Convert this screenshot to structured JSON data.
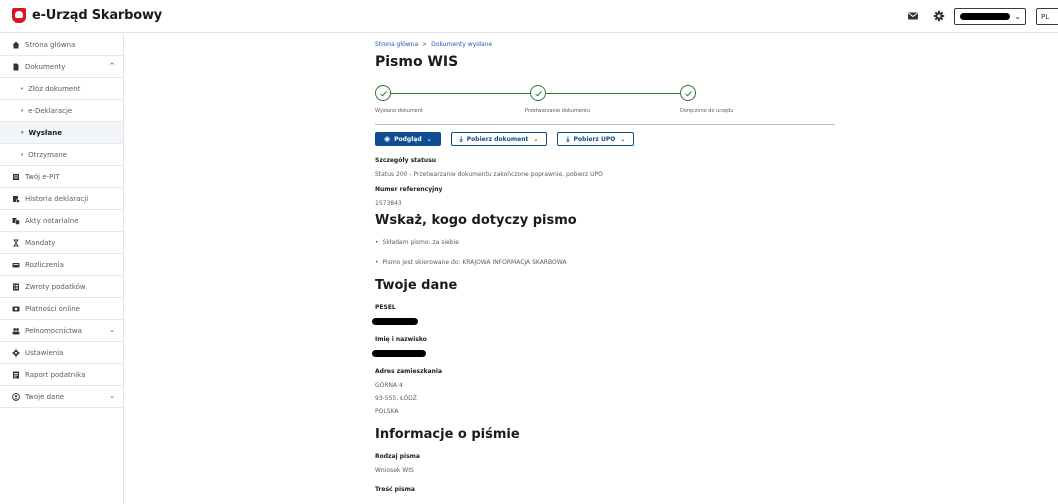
{
  "header": {
    "app_title": "e-Urząd Skarbowy",
    "lang": "PL"
  },
  "sidebar": {
    "items": [
      {
        "label": "Strona główna",
        "icon": "home-icon"
      },
      {
        "label": "Dokumenty",
        "icon": "document-icon",
        "expanded": true
      },
      {
        "label": "Złóż dokument",
        "sub": true
      },
      {
        "label": "e-Deklaracje",
        "sub": true
      },
      {
        "label": "Wysłane",
        "sub": true,
        "active": true
      },
      {
        "label": "Otrzymane",
        "sub": true
      },
      {
        "label": "Twój e-PIT",
        "icon": "pit-icon"
      },
      {
        "label": "Historia deklaracji",
        "icon": "history-icon"
      },
      {
        "label": "Akty notarialne",
        "icon": "notary-icon"
      },
      {
        "label": "Mandaty",
        "icon": "ticket-icon"
      },
      {
        "label": "Rozliczenia",
        "icon": "settlement-icon"
      },
      {
        "label": "Zwroty podatków",
        "icon": "refund-icon"
      },
      {
        "label": "Płatności online",
        "icon": "payment-icon"
      },
      {
        "label": "Pełnomocnictwa",
        "icon": "proxy-icon",
        "expandable": true
      },
      {
        "label": "Ustawienia",
        "icon": "gear-icon"
      },
      {
        "label": "Raport podatnika",
        "icon": "report-icon"
      },
      {
        "label": "Twoje dane",
        "icon": "user-icon",
        "expandable": true
      }
    ]
  },
  "breadcrumb": {
    "home": "Strona główna",
    "separator": ">",
    "current": "Dokumenty wysłane"
  },
  "page_title": "Pismo WIS",
  "stepper": {
    "steps": [
      {
        "label": "Wysłano dokument"
      },
      {
        "label": "Przetwarzanie dokumentu"
      },
      {
        "label": "Doręczono do urzędu"
      }
    ]
  },
  "actions": {
    "preview": "Podgląd",
    "download_doc": "Pobierz dokument",
    "download_upo": "Pobierz UPO"
  },
  "status": {
    "details_label": "Szczegóły statusu",
    "details_value": "Status 200 - Przetwarzanie dokumentu zakończone poprawnie, pobierz UPO",
    "ref_label": "Numer referencyjny",
    "ref_value": "1573843"
  },
  "concerns": {
    "heading": "Wskaż, kogo dotyczy pismo",
    "item1": "Składam pismo: za siebie",
    "item2": "Pismo jest skierowane do: KRAJOWA INFORMACJA SKARBOWA"
  },
  "your_data": {
    "heading": "Twoje dane",
    "pesel_label": "PESEL",
    "name_label": "Imię i nazwisko",
    "address_label": "Adres zamieszkania",
    "address_line1": "GÓRNA 4",
    "address_line2": "93-555, ŁÓDŹ",
    "address_line3": "POLSKA"
  },
  "letter_info": {
    "heading": "Informacje o piśmie",
    "type_label": "Rodzaj pisma",
    "type_value": "Wniosek WIS",
    "content_label": "Treść pisma"
  },
  "colors": {
    "primary": "#0f4d92",
    "step_done": "#2a7a3a",
    "link": "#1a5fb4"
  }
}
